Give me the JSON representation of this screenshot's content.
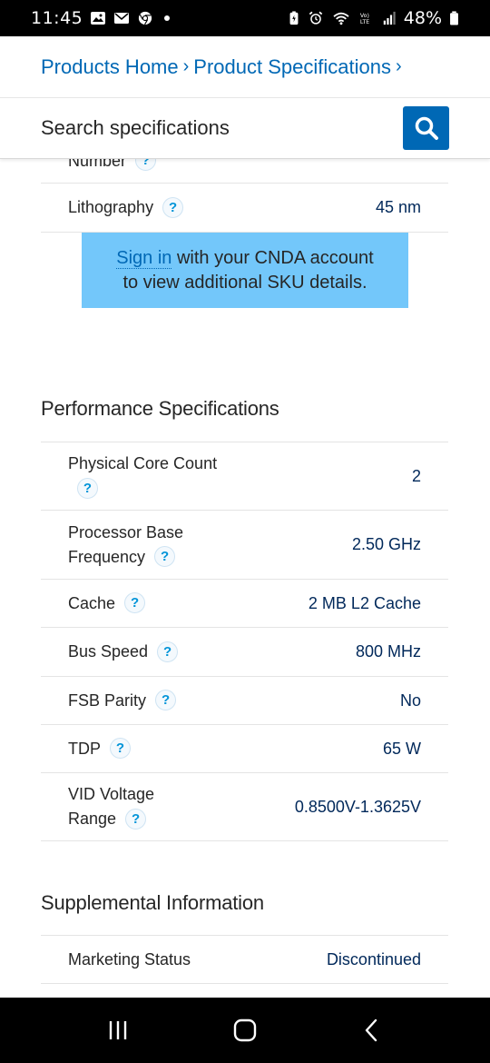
{
  "status_bar": {
    "time": "11:45",
    "battery": "48%",
    "left_icons": [
      "image-icon",
      "mail-icon",
      "chrome-icon"
    ],
    "right_icons": [
      "battery-saver-icon",
      "alarm-icon",
      "wifi-icon",
      "volte-icon",
      "signal-icon",
      "battery-icon"
    ]
  },
  "breadcrumb": {
    "items": [
      "Products Home",
      "Product Specifications"
    ],
    "separator": "›"
  },
  "search": {
    "label": "Search specifications",
    "button_icon": "search-icon"
  },
  "cnda": {
    "link": "Sign in",
    "line1_rest": " with your CNDA account",
    "line2": "to view additional SKU details."
  },
  "partial_row": {
    "label": "Number"
  },
  "lithography": {
    "label": "Lithography",
    "value": "45 nm"
  },
  "performance": {
    "title": "Performance Specifications",
    "rows": [
      {
        "label": "Physical Core Count",
        "value": "2"
      },
      {
        "label": "Processor Base Frequency",
        "value": "2.50 GHz"
      },
      {
        "label": "Cache",
        "value": "2 MB L2 Cache"
      },
      {
        "label": "Bus Speed",
        "value": "800 MHz"
      },
      {
        "label": "FSB Parity",
        "value": "No"
      },
      {
        "label": "TDP",
        "value": "65 W"
      },
      {
        "label": "VID Voltage Range",
        "value": "0.8500V-1.3625V"
      }
    ]
  },
  "supplemental": {
    "title": "Supplemental Information",
    "rows": [
      {
        "label": "Marketing Status",
        "value": "Discontinued"
      }
    ]
  },
  "help_glyph": "?",
  "colors": {
    "link": "#0068b5",
    "search_button": "#0068b5",
    "cnda_bg": "#73c7fa",
    "value_text": "#00285a",
    "help_icon": "#0094d8"
  },
  "nav_bar": {
    "buttons": [
      "recent-apps-icon",
      "home-icon",
      "back-icon"
    ]
  }
}
